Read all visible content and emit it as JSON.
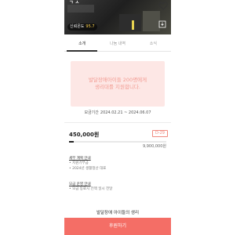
{
  "hero": {
    "title_fragment": "ㄱ ㅅ",
    "trust_label": "신뢰온도",
    "trust_value": "95.7"
  },
  "tabs": [
    {
      "label": "소개",
      "active": true
    },
    {
      "label": "나눔 내역",
      "active": false
    },
    {
      "label": "소식",
      "active": false
    }
  ],
  "banner": {
    "line1": "발달장애아이들 200명에게",
    "line2": "생리대를 지원합니다."
  },
  "period": {
    "label": "모금기간",
    "value": "2024.02.21 ~ 2024.06.07"
  },
  "funding": {
    "raised": "450,000원",
    "dday": "D-29",
    "goal": "9,900,000원",
    "progress_percent": 4.5
  },
  "info_sections": [
    {
      "title": "세부 계획 안내",
      "items": [
        "• 지원기부금",
        "• 2024년 생활정산 대표"
      ]
    },
    {
      "title": "모금 운영 안내",
      "items": [
        "• 모금 동료시 전액 일시 전달"
      ]
    }
  ],
  "section_title": "발달장애 아이들의 생리",
  "cta_label": "후원하기",
  "colors": {
    "accent": "#f46e66",
    "banner_bg": "#fde7e5",
    "banner_text": "#f29b92"
  }
}
